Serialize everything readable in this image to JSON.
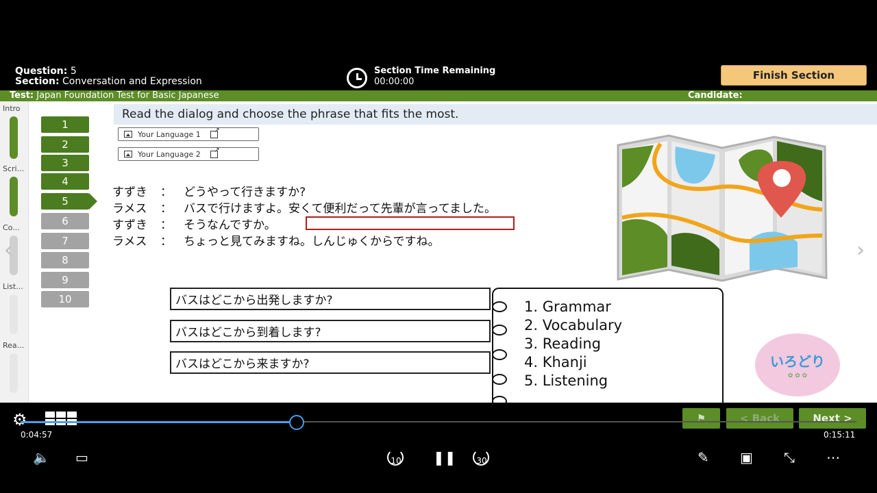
{
  "header": {
    "question_label": "Question:",
    "question_number": "5",
    "section_label": "Section:",
    "section_name": "Conversation and Expression",
    "timer_title": "Section Time Remaining",
    "timer_value": "00:00:00",
    "finish_button": "Finish Section"
  },
  "test_bar": {
    "test_label": "Test:",
    "test_name": "Japan Foundation Test for Basic Japanese",
    "candidate_label": "Candidate:"
  },
  "sections": {
    "items": [
      {
        "label": "Intro",
        "status_color": "#5c8d26"
      },
      {
        "label": "Scri...",
        "status_color": "#5c8d26"
      },
      {
        "label": "Co...",
        "status_color": "#cfcfcf"
      },
      {
        "label": "List...",
        "status_color": "#e6e6e6"
      },
      {
        "label": "Rea...",
        "status_color": "#e6e6e6"
      }
    ]
  },
  "question_nav": {
    "items": [
      {
        "label": "1",
        "state": "done"
      },
      {
        "label": "2",
        "state": "done"
      },
      {
        "label": "3",
        "state": "done"
      },
      {
        "label": "4",
        "state": "done"
      },
      {
        "label": "5",
        "state": "current"
      },
      {
        "label": "6",
        "state": "todo"
      },
      {
        "label": "7",
        "state": "todo"
      },
      {
        "label": "8",
        "state": "todo"
      },
      {
        "label": "9",
        "state": "todo"
      },
      {
        "label": "10",
        "state": "todo"
      }
    ]
  },
  "main": {
    "instruction": "Read the dialog and choose the phrase that fits the most.",
    "language_buttons": [
      "Your Language 1",
      "Your Language 2"
    ],
    "dialog": [
      {
        "speaker": "すずき",
        "colon": "：",
        "text": "どうやって行きますか?"
      },
      {
        "speaker": "ラメス",
        "colon": "：",
        "text": "バスで行けますよ。安くて便利だって先輩が言ってました。"
      },
      {
        "speaker": "すずき",
        "colon": "：",
        "text": "そうなんですか。"
      },
      {
        "speaker": "ラメス",
        "colon": "：",
        "text": "ちょっと見てみますね。しんじゅくからですね。"
      }
    ]
  },
  "choices": [
    "バスはどこから出発しますか?",
    "バスはどこから到着します?",
    "バスはどこから来ますか?"
  ],
  "notebook": {
    "items": [
      "1. Grammar",
      "2. Vocabulary",
      "3. Reading",
      "4. Khanji",
      "5. Listening"
    ]
  },
  "logo": {
    "text": "いろどり"
  },
  "footer": {
    "back_button": "< Back",
    "next_button": "Next >"
  },
  "player": {
    "elapsed": "0:04:57",
    "total": "0:15:11",
    "progress_fraction": 0.33,
    "skip_back_label": "10",
    "skip_forward_label": "30"
  },
  "colors": {
    "green": "#5c8d26",
    "finish_button": "#f5c77b",
    "blank_border": "#b11d1d",
    "player_accent": "#4a9fe8"
  }
}
